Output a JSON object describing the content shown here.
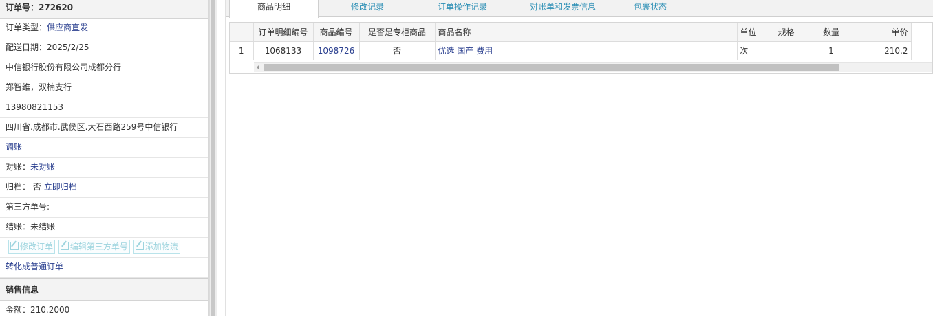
{
  "order": {
    "title": "订单号：272620",
    "type_label": "订单类型：",
    "type_value": "供应商直发",
    "date": "配送日期：2025/2/25",
    "company": "中信银行股份有限公司成都分行",
    "contact": "郑智维，双楠支行",
    "phone": "13980821153",
    "address": "四川省.成都市.武侯区.大石西路259号中信银行",
    "adjust_link": "调账",
    "recon_label": "对账：",
    "recon_value": "未对账",
    "archive_label": "归档：",
    "archive_value": "否",
    "archive_link": "立即归档",
    "third_party_label": "第三方单号:",
    "settle_label": "结账：",
    "settle_value": "未结账",
    "buttons": [
      "修改订单",
      "编辑第三方单号",
      "添加物流"
    ],
    "convert_link": "转化成普通订单"
  },
  "sales": {
    "title": "销售信息",
    "amount": "金额：210.2000"
  },
  "tabs": [
    "商品明细",
    "修改记录",
    "订单操作记录",
    "对账单和发票信息",
    "包裹状态"
  ],
  "active_tab": "商品明细",
  "grid": {
    "headers": [
      "",
      "订单明细编号",
      "商品编号",
      "是否是专柜商品",
      "商品名称",
      "单位",
      "规格",
      "数量",
      "单价"
    ],
    "rows": [
      [
        "1",
        "1068133",
        "1098726",
        "否",
        "优选 国产 费用",
        "次",
        "",
        "1",
        "210.2"
      ]
    ]
  }
}
